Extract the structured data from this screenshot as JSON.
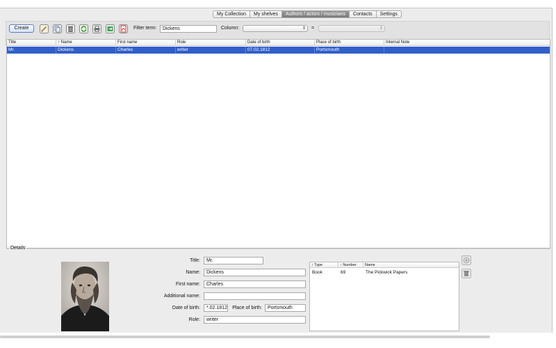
{
  "tabs": [
    {
      "label": "My Collection",
      "active": false
    },
    {
      "label": "My shelves",
      "active": false
    },
    {
      "label": "Authors / actors / musicians",
      "active": true
    },
    {
      "label": "Contacts",
      "active": false
    },
    {
      "label": "Settings",
      "active": false
    }
  ],
  "toolbar": {
    "create_label": "Create",
    "icons": [
      "edit-icon",
      "copy-icon",
      "trash-icon",
      "refresh-icon",
      "print-icon",
      "export-icon",
      "pdf-icon"
    ],
    "filter_label": "Filter term:",
    "filter_value": "Dickens",
    "column_label": "Column:",
    "column_value": "",
    "equals_label": "=",
    "value_select": ""
  },
  "table": {
    "columns": [
      "Title",
      "↑ Name",
      "First name",
      "Role",
      "Date of birth",
      "Place of birth",
      "Internal Note"
    ],
    "rows": [
      [
        "Mr.",
        "Dickens",
        "Charles",
        "writer",
        "07.02.1812",
        "Portsmouth",
        ""
      ]
    ]
  },
  "details": {
    "group_title": "Details",
    "labels": {
      "title": "Title:",
      "name": "Name:",
      "first_name": "First name:",
      "additional_name": "Additional name:",
      "date_of_birth": "Date of birth:",
      "place_of_birth": "Place of birth:",
      "role": "Role:"
    },
    "values": {
      "title": "Mr.",
      "name": "Dickens",
      "first_name": "Charles",
      "additional_name": "",
      "date_of_birth": "*.02.1812",
      "place_of_birth": "Portsmouth",
      "role": "writer"
    },
    "works": {
      "columns": [
        "↑ Type",
        "↑ Number",
        "Name"
      ],
      "rows": [
        [
          "Book",
          "69",
          "The Pickwick Papers"
        ]
      ]
    },
    "side_icons": [
      "gear-icon",
      "delete-icon"
    ]
  }
}
